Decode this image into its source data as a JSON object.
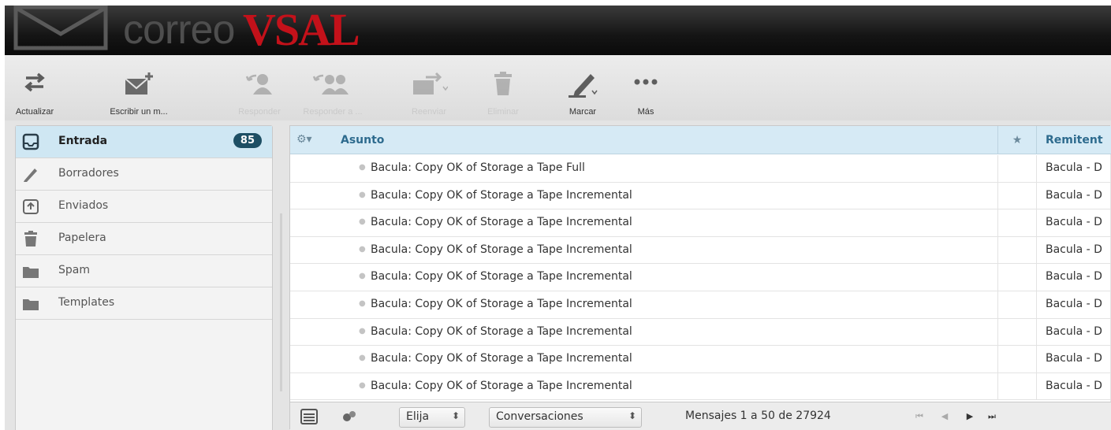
{
  "app": {
    "logo_word": "correo",
    "logo_brand": "VSAL"
  },
  "toolbar": [
    {
      "key": "refresh",
      "label": "Actualizar",
      "icon": "refresh-icon",
      "enabled": true
    },
    {
      "key": "compose",
      "label": "Escribir un m...",
      "icon": "compose-icon",
      "enabled": true
    },
    {
      "key": "reply",
      "label": "Responder",
      "icon": "reply-icon",
      "enabled": false
    },
    {
      "key": "reply-all",
      "label": "Responder a ...",
      "icon": "reply-all-icon",
      "enabled": false
    },
    {
      "key": "forward",
      "label": "Reenviar",
      "icon": "forward-icon",
      "enabled": false
    },
    {
      "key": "delete",
      "label": "Eliminar",
      "icon": "trash-icon",
      "enabled": false
    },
    {
      "key": "mark",
      "label": "Marcar",
      "icon": "pen-icon",
      "enabled": true
    },
    {
      "key": "more",
      "label": "Más",
      "icon": "more-icon",
      "enabled": true
    }
  ],
  "folders": [
    {
      "name": "Entrada",
      "icon": "inbox-icon",
      "selected": true,
      "unread": "85"
    },
    {
      "name": "Borradores",
      "icon": "pencil-icon",
      "selected": false
    },
    {
      "name": "Enviados",
      "icon": "sent-icon",
      "selected": false
    },
    {
      "name": "Papelera",
      "icon": "trash-icon",
      "selected": false
    },
    {
      "name": "Spam",
      "icon": "folder-icon",
      "selected": false
    },
    {
      "name": "Templates",
      "icon": "folder-icon",
      "selected": false
    }
  ],
  "list": {
    "header": {
      "subject": "Asunto",
      "star": "★",
      "from": "Remitent"
    },
    "rows": [
      {
        "subject": "Bacula: Copy OK of Storage a Tape Full",
        "from": "Bacula - D"
      },
      {
        "subject": "Bacula: Copy OK of Storage a Tape Incremental",
        "from": "Bacula - D"
      },
      {
        "subject": "Bacula: Copy OK of Storage a Tape Incremental",
        "from": "Bacula - D"
      },
      {
        "subject": "Bacula: Copy OK of Storage a Tape Incremental",
        "from": "Bacula - D"
      },
      {
        "subject": "Bacula: Copy OK of Storage a Tape Incremental",
        "from": "Bacula - D"
      },
      {
        "subject": "Bacula: Copy OK of Storage a Tape Incremental",
        "from": "Bacula - D"
      },
      {
        "subject": "Bacula: Copy OK of Storage a Tape Incremental",
        "from": "Bacula - D"
      },
      {
        "subject": "Bacula: Copy OK of Storage a Tape Incremental",
        "from": "Bacula - D"
      },
      {
        "subject": "Bacula: Copy OK of Storage a Tape Incremental",
        "from": "Bacula - D"
      }
    ]
  },
  "footer": {
    "select_label": "Elija",
    "threads_label": "Conversaciones",
    "count_text": "Mensajes 1 a 50 de 27924"
  },
  "colors": {
    "accent_red": "#c3111a",
    "selected_bg": "#cfe7f3",
    "badge_bg": "#1e4f64",
    "header_text": "#2e6b8e"
  }
}
